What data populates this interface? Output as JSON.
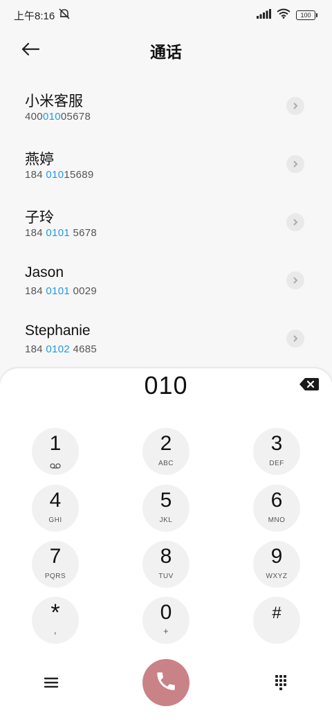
{
  "status_bar": {
    "time": "上午8:16",
    "battery": "100"
  },
  "header": {
    "title": "通话"
  },
  "contacts": [
    {
      "name": "小米客服",
      "num_pre": "400",
      "num_hl": "010",
      "num_post": "05678"
    },
    {
      "name": "燕婷",
      "num_pre": "184 ",
      "num_hl": "010",
      "num_post": "15689"
    },
    {
      "name": "子玲",
      "num_pre": "184 ",
      "num_hl": "0101",
      "num_post": " 5678"
    },
    {
      "name": "Jason",
      "num_pre": "184 ",
      "num_hl": "0101",
      "num_post": " 0029"
    },
    {
      "name": "Stephanie",
      "num_pre": "184 ",
      "num_hl": "0102",
      "num_post": " 4685"
    }
  ],
  "dialpad": {
    "entry": "010",
    "keys": [
      {
        "digit": "1",
        "letters": ""
      },
      {
        "digit": "2",
        "letters": "ABC"
      },
      {
        "digit": "3",
        "letters": "DEF"
      },
      {
        "digit": "4",
        "letters": "GHI"
      },
      {
        "digit": "5",
        "letters": "JKL"
      },
      {
        "digit": "6",
        "letters": "MNO"
      },
      {
        "digit": "7",
        "letters": "PQRS"
      },
      {
        "digit": "8",
        "letters": "TUV"
      },
      {
        "digit": "9",
        "letters": "WXYZ"
      },
      {
        "digit": "*",
        "letters": ","
      },
      {
        "digit": "0",
        "letters": "+"
      },
      {
        "digit": "#",
        "letters": ""
      }
    ]
  },
  "colors": {
    "highlight": "#1e9be3",
    "call_button": "#c98286"
  }
}
